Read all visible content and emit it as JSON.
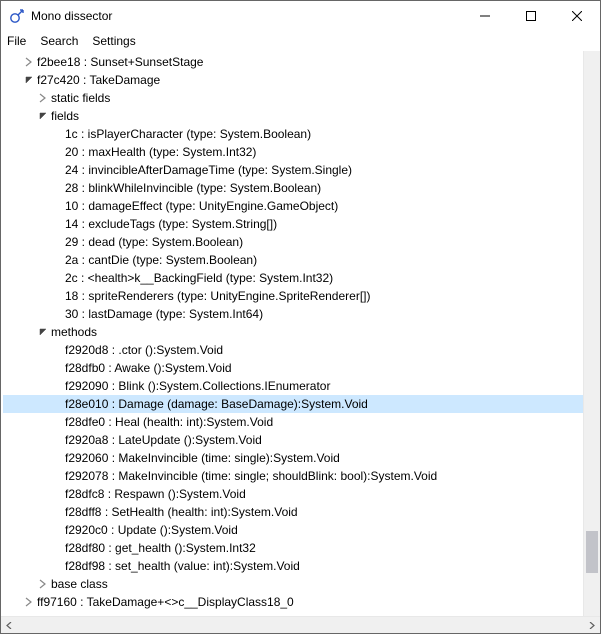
{
  "window": {
    "title": "Mono dissector"
  },
  "menu": {
    "file": "File",
    "search": "Search",
    "settings": "Settings"
  },
  "tree": [
    {
      "depth": 1,
      "caret": "closed",
      "text": "f2bee18 : Sunset+SunsetStage"
    },
    {
      "depth": 1,
      "caret": "open",
      "text": "f27c420 : TakeDamage"
    },
    {
      "depth": 2,
      "caret": "closed",
      "text": "static fields"
    },
    {
      "depth": 2,
      "caret": "open",
      "text": "fields"
    },
    {
      "depth": 3,
      "caret": "none",
      "text": "1c : isPlayerCharacter (type: System.Boolean)"
    },
    {
      "depth": 3,
      "caret": "none",
      "text": "20 : maxHealth (type: System.Int32)"
    },
    {
      "depth": 3,
      "caret": "none",
      "text": "24 : invincibleAfterDamageTime (type: System.Single)"
    },
    {
      "depth": 3,
      "caret": "none",
      "text": "28 : blinkWhileInvincible (type: System.Boolean)"
    },
    {
      "depth": 3,
      "caret": "none",
      "text": "10 : damageEffect (type: UnityEngine.GameObject)"
    },
    {
      "depth": 3,
      "caret": "none",
      "text": "14 : excludeTags (type: System.String[])"
    },
    {
      "depth": 3,
      "caret": "none",
      "text": "29 : dead (type: System.Boolean)"
    },
    {
      "depth": 3,
      "caret": "none",
      "text": "2a : cantDie (type: System.Boolean)"
    },
    {
      "depth": 3,
      "caret": "none",
      "text": "2c : <health>k__BackingField (type: System.Int32)"
    },
    {
      "depth": 3,
      "caret": "none",
      "text": "18 : spriteRenderers (type: UnityEngine.SpriteRenderer[])"
    },
    {
      "depth": 3,
      "caret": "none",
      "text": "30 : lastDamage (type: System.Int64)"
    },
    {
      "depth": 2,
      "caret": "open",
      "text": "methods"
    },
    {
      "depth": 3,
      "caret": "none",
      "text": "f2920d8 : .ctor ():System.Void"
    },
    {
      "depth": 3,
      "caret": "none",
      "text": "f28dfb0 : Awake ():System.Void"
    },
    {
      "depth": 3,
      "caret": "none",
      "text": "f292090 : Blink ():System.Collections.IEnumerator"
    },
    {
      "depth": 3,
      "caret": "none",
      "text": "f28e010 : Damage (damage: BaseDamage):System.Void",
      "selected": true
    },
    {
      "depth": 3,
      "caret": "none",
      "text": "f28dfe0 : Heal (health: int):System.Void"
    },
    {
      "depth": 3,
      "caret": "none",
      "text": "f2920a8 : LateUpdate ():System.Void"
    },
    {
      "depth": 3,
      "caret": "none",
      "text": "f292060 : MakeInvincible (time: single):System.Void"
    },
    {
      "depth": 3,
      "caret": "none",
      "text": "f292078 : MakeInvincible (time: single; shouldBlink: bool):System.Void"
    },
    {
      "depth": 3,
      "caret": "none",
      "text": "f28dfc8 : Respawn ():System.Void"
    },
    {
      "depth": 3,
      "caret": "none",
      "text": "f28dff8 : SetHealth (health: int):System.Void"
    },
    {
      "depth": 3,
      "caret": "none",
      "text": "f2920c0 : Update ():System.Void"
    },
    {
      "depth": 3,
      "caret": "none",
      "text": "f28df80 : get_health ():System.Int32"
    },
    {
      "depth": 3,
      "caret": "none",
      "text": "f28df98 : set_health (value: int):System.Void"
    },
    {
      "depth": 2,
      "caret": "closed",
      "text": "base class"
    },
    {
      "depth": 1,
      "caret": "closed",
      "text": "ff97160 : TakeDamage+<>c__DisplayClass18_0"
    }
  ]
}
